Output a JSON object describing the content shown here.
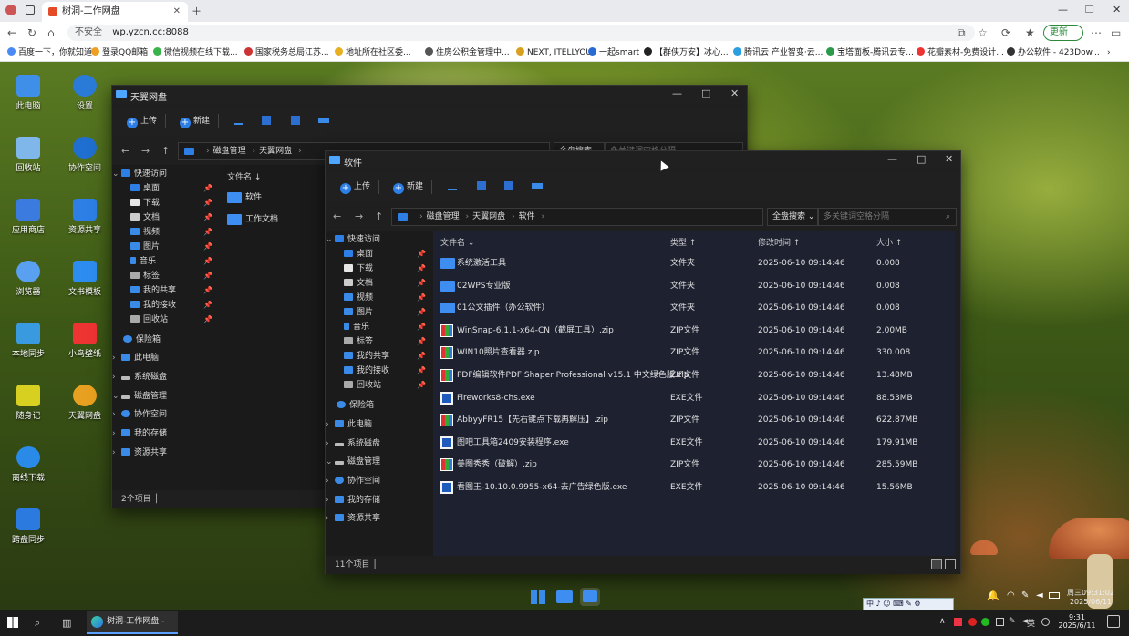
{
  "browser": {
    "tab_title": "树洞-工作网盘",
    "address_insecure": "不安全",
    "address_url": "wp.yzcn.cc:8088",
    "update_button": "更新",
    "bookmarks": [
      "百度一下，你就知道",
      "登录QQ邮箱",
      "微信视频在线下载...",
      "国家税务总局江苏...",
      "地址所在社区委...",
      "住房公积金管理中...",
      "NEXT, ITELLYOU",
      "一起smart",
      "【群侠万安】冰心...",
      "腾讯云 产业智变·云...",
      "宝塔面板-腾讯云专...",
      "花瓣素材-免费设计...",
      "办公软件 - 423Dow..."
    ]
  },
  "desktop_icons": [
    "此电脑",
    "设置",
    "回收站",
    "协作空间",
    "应用商店",
    "资源共享",
    "浏览器",
    "文书模板",
    "本地同步",
    "小鸟壁纸",
    "随身记",
    "天翼网盘",
    "离线下载",
    "跨盘同步"
  ],
  "back_window": {
    "title": "天翼网盘",
    "toolbar": {
      "upload": "上传",
      "new": "新建"
    },
    "search_scope": "全盘搜索",
    "search_placeholder": "多关键词空格分隔",
    "breadcrumb": [
      "磁盘管理",
      "天翼网盘"
    ],
    "quick_access": "快速访问",
    "nav_items": [
      "桌面",
      "下载",
      "文档",
      "视频",
      "图片",
      "音乐",
      "标签",
      "我的共享",
      "我的接收",
      "回收站",
      "保险箱",
      "此电脑",
      "系统磁盘",
      "磁盘管理",
      "协作空间",
      "我的存储",
      "资源共享"
    ],
    "col_name": "文件名",
    "files": [
      "软件",
      "工作文档"
    ],
    "status": "2个项目"
  },
  "front_window": {
    "title": "软件",
    "toolbar": {
      "upload": "上传",
      "new": "新建"
    },
    "breadcrumb": [
      "磁盘管理",
      "天翼网盘",
      "软件"
    ],
    "search_scope": "全盘搜索",
    "search_placeholder": "多关键词空格分隔",
    "quick_access": "快速访问",
    "nav_items": [
      "桌面",
      "下载",
      "文档",
      "视频",
      "图片",
      "音乐",
      "标签",
      "我的共享",
      "我的接收",
      "回收站",
      "保险箱",
      "此电脑",
      "系统磁盘",
      "磁盘管理",
      "协作空间",
      "我的存储",
      "资源共享"
    ],
    "columns": {
      "name": "文件名",
      "type": "类型",
      "modified": "修改时间",
      "size": "大小"
    },
    "files": [
      {
        "name": "系统激活工具",
        "type": "文件夹",
        "modified": "2025-06-10 09:14:46",
        "size": "0.008",
        "kind": "folder"
      },
      {
        "name": "02WPS专业版",
        "type": "文件夹",
        "modified": "2025-06-10 09:14:46",
        "size": "0.008",
        "kind": "folder"
      },
      {
        "name": "01公文插件（办公软件）",
        "type": "文件夹",
        "modified": "2025-06-10 09:14:46",
        "size": "0.008",
        "kind": "folder"
      },
      {
        "name": "WinSnap-6.1.1-x64-CN（截屏工具）.zip",
        "type": "ZIP文件",
        "modified": "2025-06-10 09:14:46",
        "size": "2.00MB",
        "kind": "zip"
      },
      {
        "name": "WIN10照片查看器.zip",
        "type": "ZIP文件",
        "modified": "2025-06-10 09:14:46",
        "size": "330.008",
        "kind": "zip"
      },
      {
        "name": "PDF编辑软件PDF Shaper Professional v15.1 中文绿色版.zip",
        "type": "ZIP文件",
        "modified": "2025-06-10 09:14:46",
        "size": "13.48MB",
        "kind": "zip"
      },
      {
        "name": "Fireworks8-chs.exe",
        "type": "EXE文件",
        "modified": "2025-06-10 09:14:46",
        "size": "88.53MB",
        "kind": "exe"
      },
      {
        "name": "AbbyyFR15【先右键点下载再解压】.zip",
        "type": "ZIP文件",
        "modified": "2025-06-10 09:14:46",
        "size": "622.87MB",
        "kind": "zip"
      },
      {
        "name": "图吧工具箱2409安装程序.exe",
        "type": "EXE文件",
        "modified": "2025-06-10 09:14:46",
        "size": "179.91MB",
        "kind": "exe"
      },
      {
        "name": "美图秀秀（破解）.zip",
        "type": "ZIP文件",
        "modified": "2025-06-10 09:14:46",
        "size": "285.59MB",
        "kind": "zip"
      },
      {
        "name": "看图王-10.10.0.9955-x64-去广告绿色版.exe",
        "type": "EXE文件",
        "modified": "2025-06-10 09:14:46",
        "size": "15.56MB",
        "kind": "exe"
      }
    ],
    "status": "11个项目"
  },
  "dock_clock": {
    "line1": "周三09:31:02",
    "line2": "2025/06/11"
  },
  "ime_bar": "中 ♪ ☺ ⌨ ✎ ⚙",
  "taskbar": {
    "app_label": "树洞-工作网盘 - 用...",
    "tray_lang": "英",
    "time": "9:31",
    "date": "2025/6/11"
  },
  "colors": {
    "accent": "#2d7fe6",
    "folder": "#3d8ef0",
    "window_bg": "#1f1f1f"
  }
}
